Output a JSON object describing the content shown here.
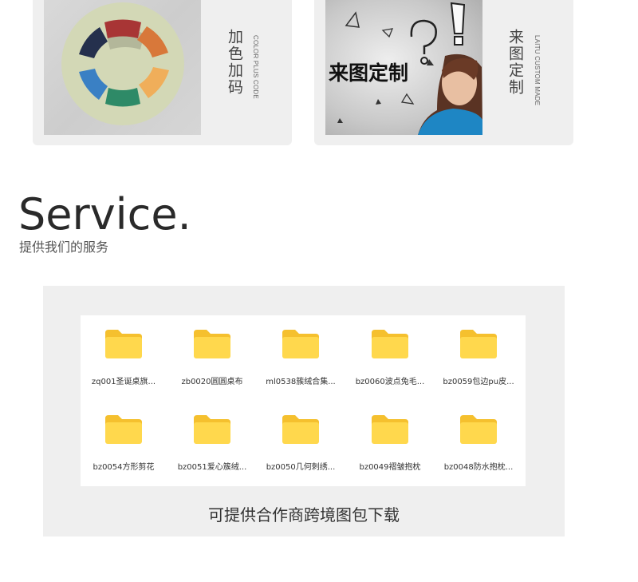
{
  "cards": [
    {
      "name": "color-card",
      "title_cn": "加色加码",
      "title_en": "COLOR PLUS CODE"
    },
    {
      "name": "custom-card",
      "title_cn": "来图定制",
      "title_en": "LAITU CUSTOM MADE",
      "image_text": "来图定制"
    }
  ],
  "service": {
    "title": "Service.",
    "subtitle": "提供我们的服务"
  },
  "folders": [
    "zq001圣诞桌旗...",
    "zb0020圆圆桌布",
    "ml0538簇绒合集...",
    "bz0060波点兔毛...",
    "bz0059包边pu皮...",
    "bz0054方形剪花",
    "bz0051爱心簇绒...",
    "bz0050几何刺绣...",
    "bz0049褶皱抱枕",
    "bz0048防水抱枕..."
  ],
  "caption": "可提供合作商跨境图包下载",
  "colors": {
    "folder": "#FFD84D",
    "folder_tab": "#F5C02E",
    "panel": "#efefef"
  }
}
